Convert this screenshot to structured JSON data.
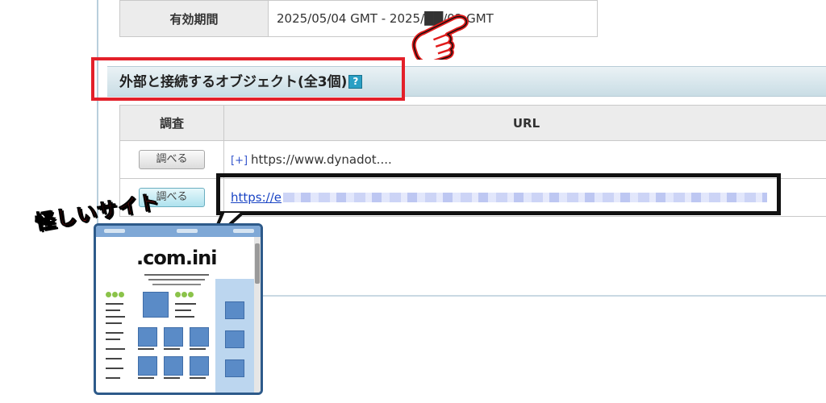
{
  "validity": {
    "label": "有効期間",
    "value": "2025/05/04 GMT - 2025/██/02 GMT"
  },
  "section": {
    "title": "外部と接続するオブジェクト(全3個)",
    "help_glyph": "?"
  },
  "objects_table": {
    "headers": [
      "調査",
      "URL"
    ],
    "rows": [
      {
        "button_label": "調べる",
        "expand_glyph": "[+]",
        "url": "https://www.dynadot...."
      },
      {
        "button_label": "調べる",
        "url": "https://e"
      }
    ]
  },
  "annotation": {
    "label": "怪しいサイト",
    "site_logo": ".com.ini"
  },
  "colors": {
    "highlight_red": "#e3202a",
    "section_bar": "#c9dde5",
    "link_blue": "#1a44c4"
  },
  "icons": [
    "pointing-hand-icon",
    "help-icon",
    "expand-icon",
    "website-illustration-icon"
  ]
}
